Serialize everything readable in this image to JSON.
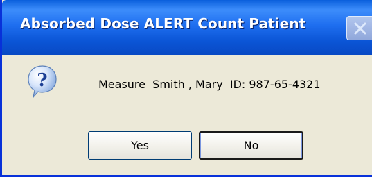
{
  "window": {
    "title": "Absorbed Dose ALERT Count Patient",
    "close_icon": "close-icon"
  },
  "dialog": {
    "icon": "question-icon",
    "message": "Measure  Smith , Mary  ID: 987-65-4321"
  },
  "buttons": {
    "yes_label": "Yes",
    "no_label": "No"
  },
  "colors": {
    "titlebar": "#0b55d6",
    "dialog_bg": "#ece9d8",
    "button_border": "#003c74"
  }
}
